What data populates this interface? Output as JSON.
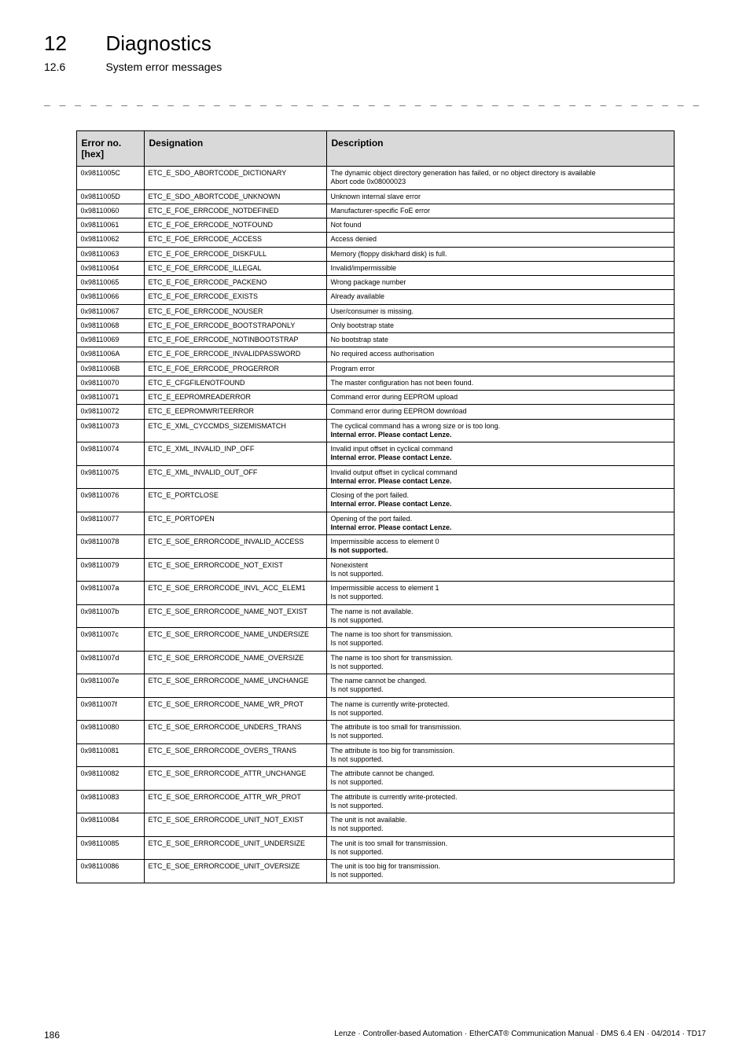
{
  "header": {
    "chapter_num": "12",
    "chapter_title": "Diagnostics",
    "section_num": "12.6",
    "section_title": "System error messages"
  },
  "dashes": "_ _ _ _ _ _ _ _ _ _ _ _ _ _ _ _ _ _ _ _ _ _ _ _ _ _ _ _ _ _ _ _ _ _ _ _ _ _ _ _ _ _ _ _ _ _ _ _ _ _ _ _ _ _ _ _ _ _ _ _ _ _ _ _",
  "table": {
    "headers": {
      "c1": "Error no.\n[hex]",
      "c2": "Designation",
      "c3": "Description"
    },
    "rows": [
      {
        "c1": "0x9811005C",
        "c2": "ETC_E_SDO_ABORTCODE_DICTIONARY",
        "c3": "The dynamic object directory generation has failed, or no object directory is available\nAbort code 0x08000023"
      },
      {
        "c1": "0x9811005D",
        "c2": "ETC_E_SDO_ABORTCODE_UNKNOWN",
        "c3": "Unknown internal slave error"
      },
      {
        "c1": "0x98110060",
        "c2": "ETC_E_FOE_ERRCODE_NOTDEFINED",
        "c3": "Manufacturer-specific FoE error"
      },
      {
        "c1": "0x98110061",
        "c2": "ETC_E_FOE_ERRCODE_NOTFOUND",
        "c3": "Not found"
      },
      {
        "c1": "0x98110062",
        "c2": "ETC_E_FOE_ERRCODE_ACCESS",
        "c3": "Access denied"
      },
      {
        "c1": "0x98110063",
        "c2": "ETC_E_FOE_ERRCODE_DISKFULL",
        "c3": "Memory (floppy disk/hard disk) is full."
      },
      {
        "c1": "0x98110064",
        "c2": "ETC_E_FOE_ERRCODE_ILLEGAL",
        "c3": "Invalid/impermissible"
      },
      {
        "c1": "0x98110065",
        "c2": "ETC_E_FOE_ERRCODE_PACKENO",
        "c3": "Wrong package number"
      },
      {
        "c1": "0x98110066",
        "c2": "ETC_E_FOE_ERRCODE_EXISTS",
        "c3": "Already available"
      },
      {
        "c1": "0x98110067",
        "c2": "ETC_E_FOE_ERRCODE_NOUSER",
        "c3": "User/consumer is missing."
      },
      {
        "c1": "0x98110068",
        "c2": "ETC_E_FOE_ERRCODE_BOOTSTRAPONLY",
        "c3": "Only bootstrap state"
      },
      {
        "c1": "0x98110069",
        "c2": "ETC_E_FOE_ERRCODE_NOTINBOOTSTRAP",
        "c3": "No bootstrap state"
      },
      {
        "c1": "0x9811006A",
        "c2": "ETC_E_FOE_ERRCODE_INVALIDPASSWORD",
        "c3": "No required access authorisation"
      },
      {
        "c1": "0x9811006B",
        "c2": "ETC_E_FOE_ERRCODE_PROGERROR",
        "c3": "Program error"
      },
      {
        "c1": "0x98110070",
        "c2": "ETC_E_CFGFILENOTFOUND",
        "c3": "The master configuration has not been found."
      },
      {
        "c1": "0x98110071",
        "c2": "ETC_E_EEPROMREADERROR",
        "c3": "Command error during EEPROM upload"
      },
      {
        "c1": "0x98110072",
        "c2": "ETC_E_EEPROMWRITEERROR",
        "c3": "Command error during EEPROM download"
      },
      {
        "c1": "0x98110073",
        "c2": "ETC_E_XML_CYCCMDS_SIZEMISMATCH",
        "c3": "The cyclical command has a wrong size or is too long.",
        "c3b": "Internal error. Please contact Lenze."
      },
      {
        "c1": "0x98110074",
        "c2": "ETC_E_XML_INVALID_INP_OFF",
        "c3": "Invalid input offset in cyclical command",
        "c3b": "Internal error. Please contact Lenze."
      },
      {
        "c1": "0x98110075",
        "c2": "ETC_E_XML_INVALID_OUT_OFF",
        "c3": "Invalid output offset in cyclical command",
        "c3b": "Internal error. Please contact Lenze."
      },
      {
        "c1": "0x98110076",
        "c2": "ETC_E_PORTCLOSE",
        "c3": "Closing of the port failed.",
        "c3b": "Internal error. Please contact Lenze."
      },
      {
        "c1": "0x98110077",
        "c2": "ETC_E_PORTOPEN",
        "c3": "Opening of the port failed.",
        "c3b": "Internal error. Please contact Lenze."
      },
      {
        "c1": "0x98110078",
        "c2": "ETC_E_SOE_ERRORCODE_INVALID_ACCESS",
        "c3": "Impermissible access to element 0",
        "c3b": "Is not supported."
      },
      {
        "c1": "0x98110079",
        "c2": "ETC_E_SOE_ERRORCODE_NOT_EXIST",
        "c3": "Nonexistent\nIs not supported."
      },
      {
        "c1": "0x9811007a",
        "c2": "ETC_E_SOE_ERRORCODE_INVL_ACC_ELEM1",
        "c3": "Impermissible access to element 1\nIs not supported."
      },
      {
        "c1": "0x9811007b",
        "c2": "ETC_E_SOE_ERRORCODE_NAME_NOT_EXIST",
        "c3": "The name is not available.\nIs not supported."
      },
      {
        "c1": "0x9811007c",
        "c2": "ETC_E_SOE_ERRORCODE_NAME_UNDERSIZE",
        "c3": "The name is too short for transmission.\nIs not supported."
      },
      {
        "c1": "0x9811007d",
        "c2": "ETC_E_SOE_ERRORCODE_NAME_OVERSIZE",
        "c3": "The name is too short for transmission.\nIs not supported."
      },
      {
        "c1": "0x9811007e",
        "c2": "ETC_E_SOE_ERRORCODE_NAME_UNCHANGE",
        "c3": "The name cannot be changed.\nIs not supported."
      },
      {
        "c1": "0x9811007f",
        "c2": "ETC_E_SOE_ERRORCODE_NAME_WR_PROT",
        "c3": "The name is currently write-protected.\nIs not supported."
      },
      {
        "c1": "0x98110080",
        "c2": "ETC_E_SOE_ERRORCODE_UNDERS_TRANS",
        "c3": "The attribute is too small for transmission.\nIs not supported."
      },
      {
        "c1": "0x98110081",
        "c2": "ETC_E_SOE_ERRORCODE_OVERS_TRANS",
        "c3": "The attribute is too big for transmission.\nIs not supported."
      },
      {
        "c1": "0x98110082",
        "c2": "ETC_E_SOE_ERRORCODE_ATTR_UNCHANGE",
        "c3": "The attribute cannot be changed.\nIs not supported."
      },
      {
        "c1": "0x98110083",
        "c2": "ETC_E_SOE_ERRORCODE_ATTR_WR_PROT",
        "c3": "The attribute is currently write-protected.\nIs not supported."
      },
      {
        "c1": "0x98110084",
        "c2": "ETC_E_SOE_ERRORCODE_UNIT_NOT_EXIST",
        "c3": "The unit is not available.\nIs not supported."
      },
      {
        "c1": "0x98110085",
        "c2": "ETC_E_SOE_ERRORCODE_UNIT_UNDERSIZE",
        "c3": "The unit is too small for transmission.\nIs not supported."
      },
      {
        "c1": "0x98110086",
        "c2": "ETC_E_SOE_ERRORCODE_UNIT_OVERSIZE",
        "c3": "The unit is too big for transmission.\nIs not supported."
      }
    ]
  },
  "footer": {
    "page": "186",
    "text": "Lenze · Controller-based Automation · EtherCAT® Communication Manual · DMS 6.4 EN · 04/2014 · TD17"
  }
}
